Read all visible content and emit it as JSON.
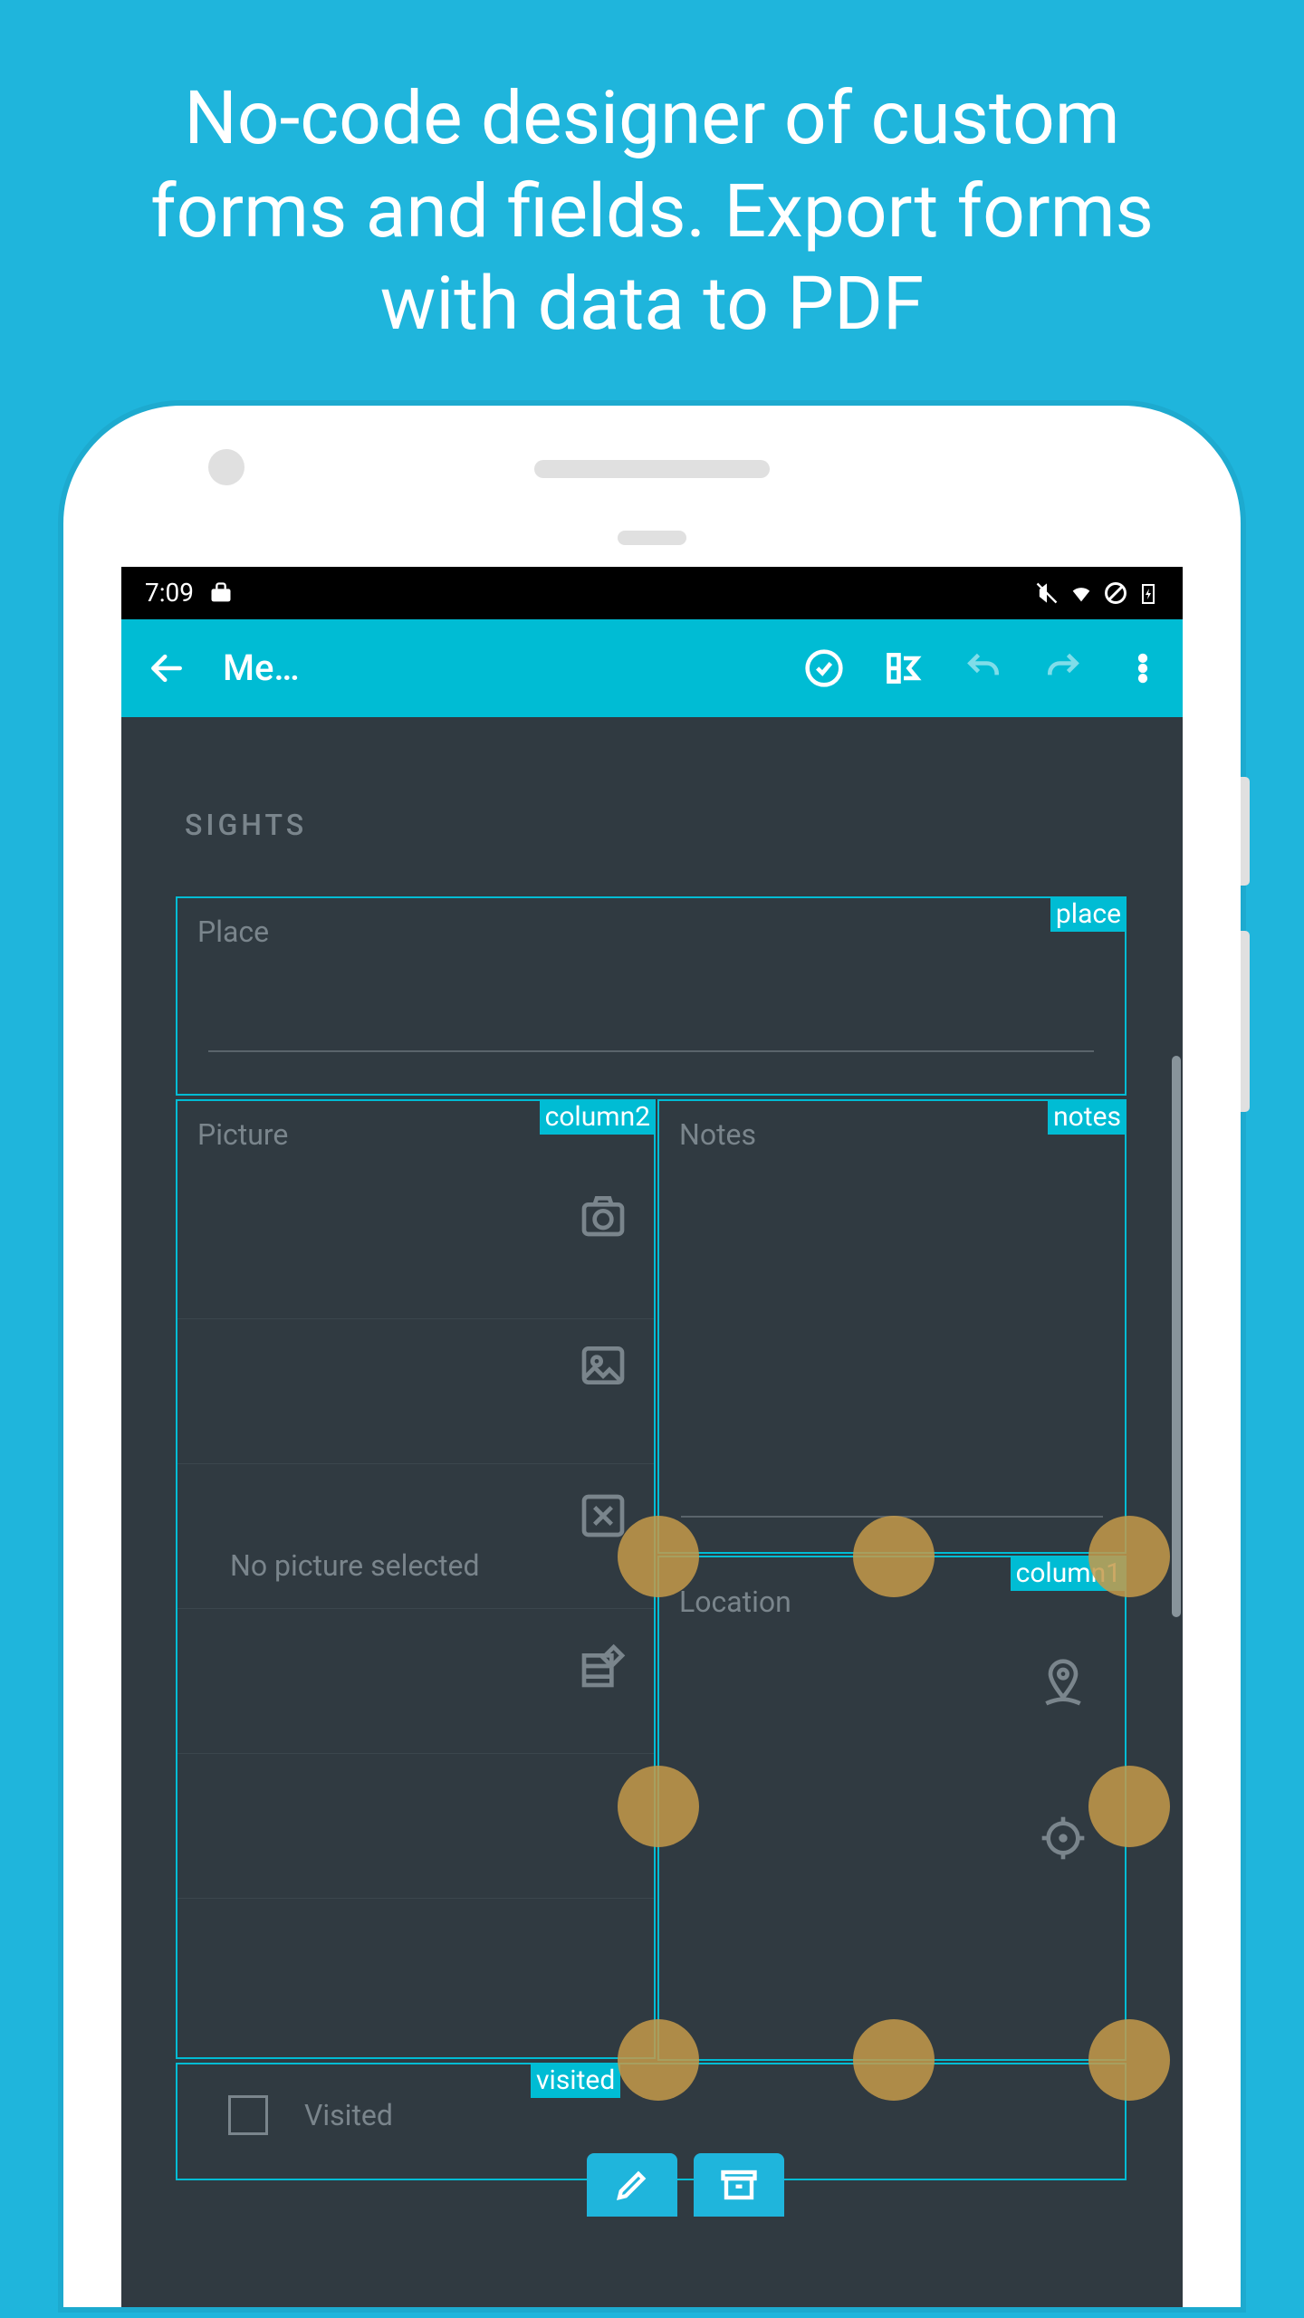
{
  "promo": "No-code designer of custom forms and fields. Export forms with data to PDF",
  "status_bar": {
    "time": "7:09"
  },
  "app_bar": {
    "title": "Me…"
  },
  "section_title": "SIGHTS",
  "fields": {
    "place": {
      "label": "Place",
      "tag": "place"
    },
    "picture": {
      "label": "Picture",
      "tag": "column2",
      "empty_text": "No picture selected"
    },
    "notes": {
      "label": "Notes",
      "tag": "notes"
    },
    "location": {
      "label": "Location",
      "tag": "column1"
    },
    "visited": {
      "label": "Visited",
      "tag": "visited"
    }
  }
}
